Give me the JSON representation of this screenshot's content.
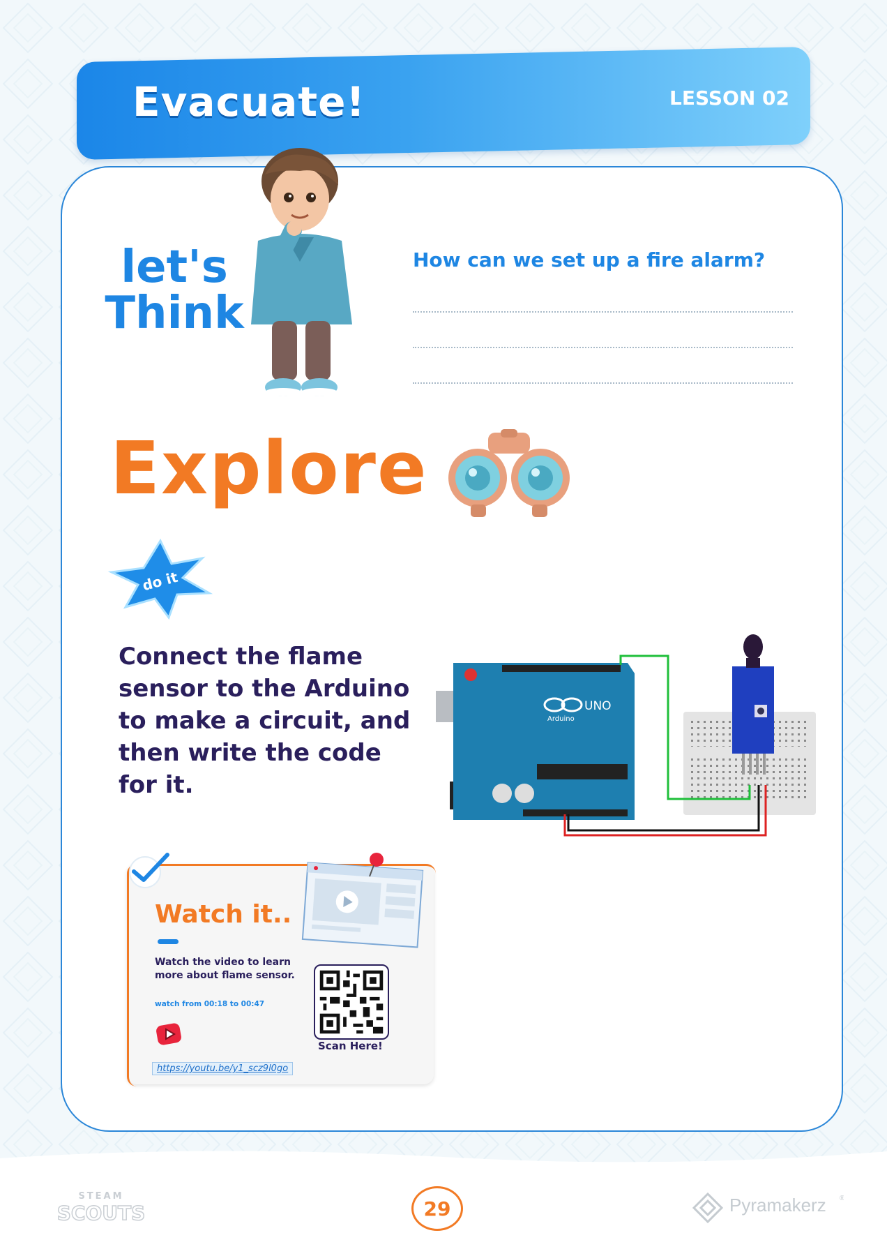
{
  "header": {
    "title": "Evacuate!",
    "lesson": "LESSON 02"
  },
  "think": {
    "heading_line1": "let's",
    "heading_line2": "Think",
    "question": "How can we set up a fire alarm?"
  },
  "explore": {
    "heading": "Explore",
    "doit_badge": "do it",
    "instructions": "Connect the flame sensor to the Arduino to make a circuit, and then write the code for it.",
    "board_label": "UNO",
    "board_brand": "Arduino"
  },
  "watch": {
    "title": "Watch it..",
    "description": "Watch the video to learn more about flame sensor.",
    "time_range": "watch from 00:18 to 00:47",
    "link": "https://youtu.be/y1_scz9l0go",
    "scan_label": "Scan Here!"
  },
  "footer": {
    "page_number": "29",
    "left_logo_top": "STEAM",
    "left_logo_bottom": "SCOUTS",
    "right_logo": "Pyramakerz",
    "right_logo_mark": "®"
  },
  "colors": {
    "primary_blue": "#1e86e3",
    "accent_orange": "#f27a24",
    "dark_text": "#2a1f5c",
    "board_teal": "#1e7fb0",
    "sensor_blue": "#1f3fbf"
  }
}
